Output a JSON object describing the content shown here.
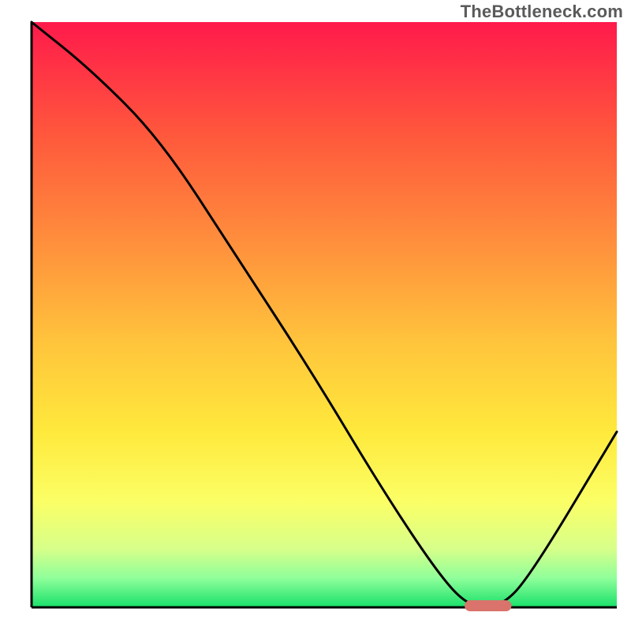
{
  "watermark": "TheBottleneck.com",
  "chart_data": {
    "type": "line",
    "title": "",
    "xlabel": "",
    "ylabel": "",
    "xlim": [
      0,
      100
    ],
    "ylim": [
      0,
      100
    ],
    "series": [
      {
        "name": "bottleneck-curve",
        "x": [
          0,
          10,
          22,
          35,
          48,
          60,
          70,
          75,
          80,
          85,
          100
        ],
        "y": [
          100,
          92,
          80,
          60,
          40,
          20,
          5,
          0,
          0,
          5,
          30
        ]
      }
    ],
    "marker": {
      "name": "optimal-range",
      "x_start": 74,
      "x_end": 82,
      "y": 0,
      "color": "#d9736c"
    },
    "background": {
      "type": "vertical-gradient",
      "stops": [
        {
          "pos": 0.0,
          "color": "#ff1a4b"
        },
        {
          "pos": 0.2,
          "color": "#ff5a3c"
        },
        {
          "pos": 0.4,
          "color": "#ff963c"
        },
        {
          "pos": 0.55,
          "color": "#ffc53c"
        },
        {
          "pos": 0.7,
          "color": "#ffe93c"
        },
        {
          "pos": 0.82,
          "color": "#fbff66"
        },
        {
          "pos": 0.9,
          "color": "#d7ff8a"
        },
        {
          "pos": 0.95,
          "color": "#8fff9a"
        },
        {
          "pos": 1.0,
          "color": "#18e06a"
        }
      ]
    },
    "axes_color": "#000000"
  }
}
